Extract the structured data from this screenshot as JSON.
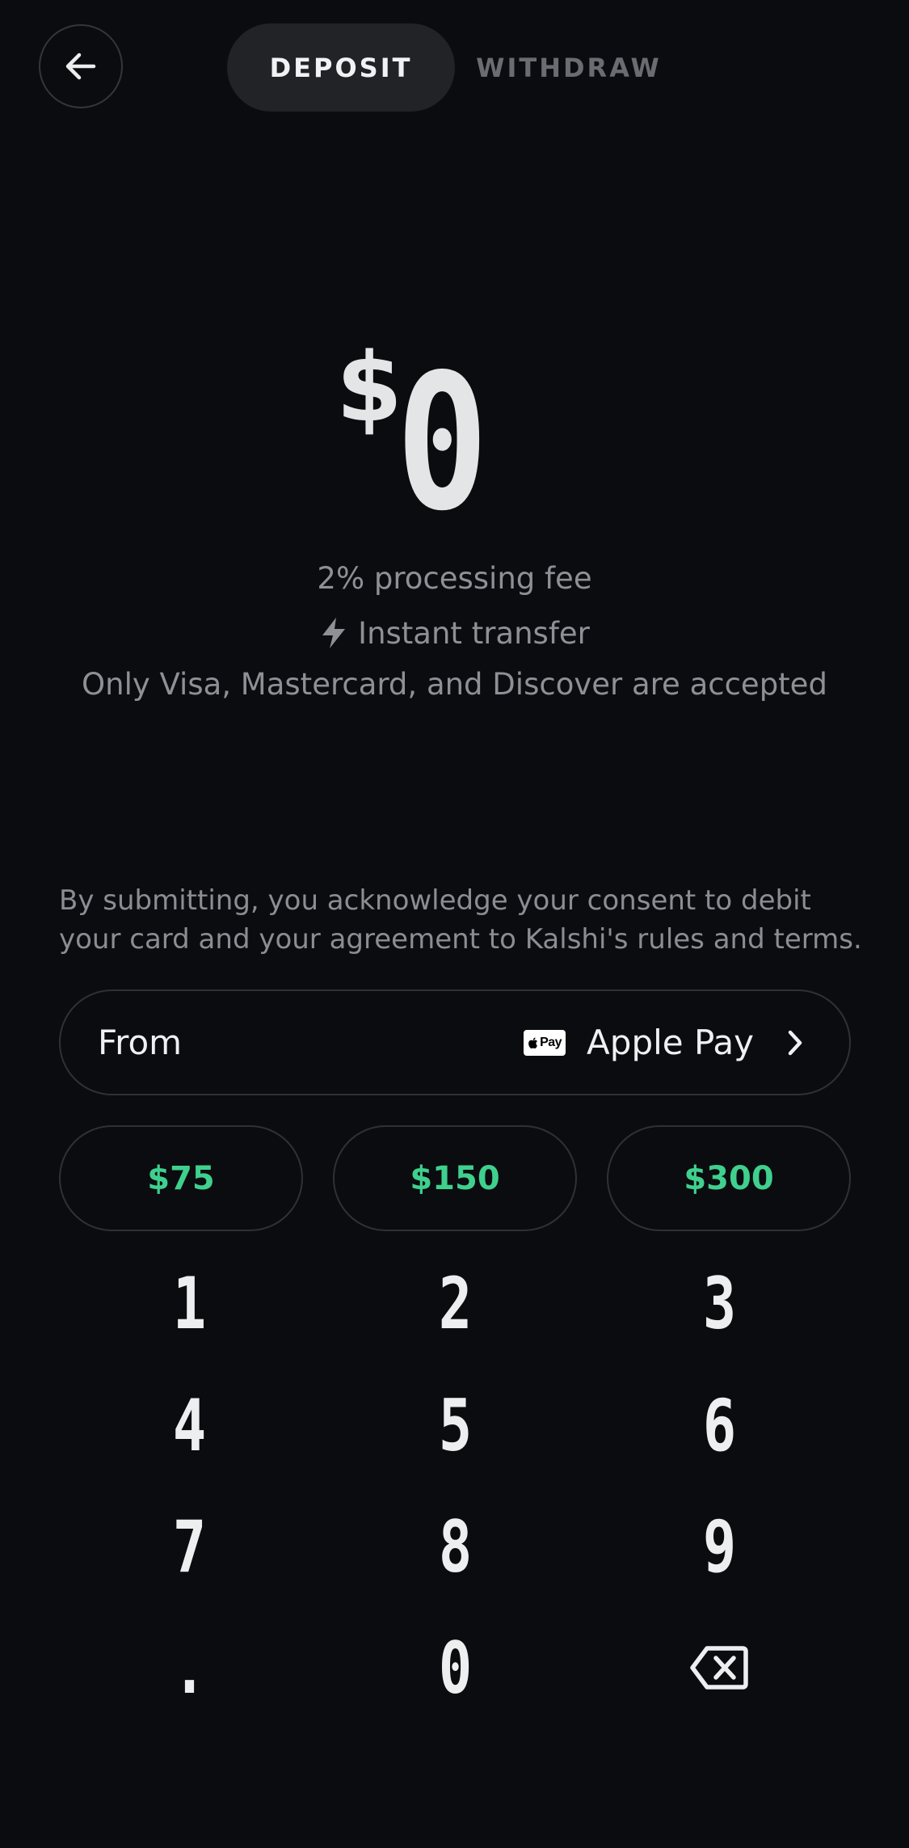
{
  "header": {
    "back_icon": "arrow-left-icon",
    "tabs": [
      {
        "label": "DEPOSIT",
        "active": true
      },
      {
        "label": "WITHDRAW",
        "active": false
      }
    ]
  },
  "amount": {
    "currency": "$",
    "value": "0"
  },
  "info": {
    "fee": "2% processing fee",
    "instant_icon": "lightning-bolt-icon",
    "instant": "Instant transfer",
    "cards": "Only Visa, Mastercard, and Discover are accepted"
  },
  "consent": "By submitting, you acknowledge your consent to debit your card and your agreement to Kalshi's rules and terms.",
  "payment": {
    "from_label": "From",
    "badge_text": "Pay",
    "method": "Apple Pay",
    "chevron_icon": "chevron-right-icon"
  },
  "presets": [
    "$75",
    "$150",
    "$300"
  ],
  "keypad": {
    "keys": [
      "1",
      "2",
      "3",
      "4",
      "5",
      "6",
      "7",
      "8",
      "9",
      ".",
      "0"
    ],
    "backspace_icon": "backspace-icon"
  },
  "colors": {
    "background": "#0b0c0f",
    "accent_green": "#3fd08e",
    "active_tab": "#222327",
    "muted_text": "#8e9095",
    "border": "#2f3136"
  }
}
